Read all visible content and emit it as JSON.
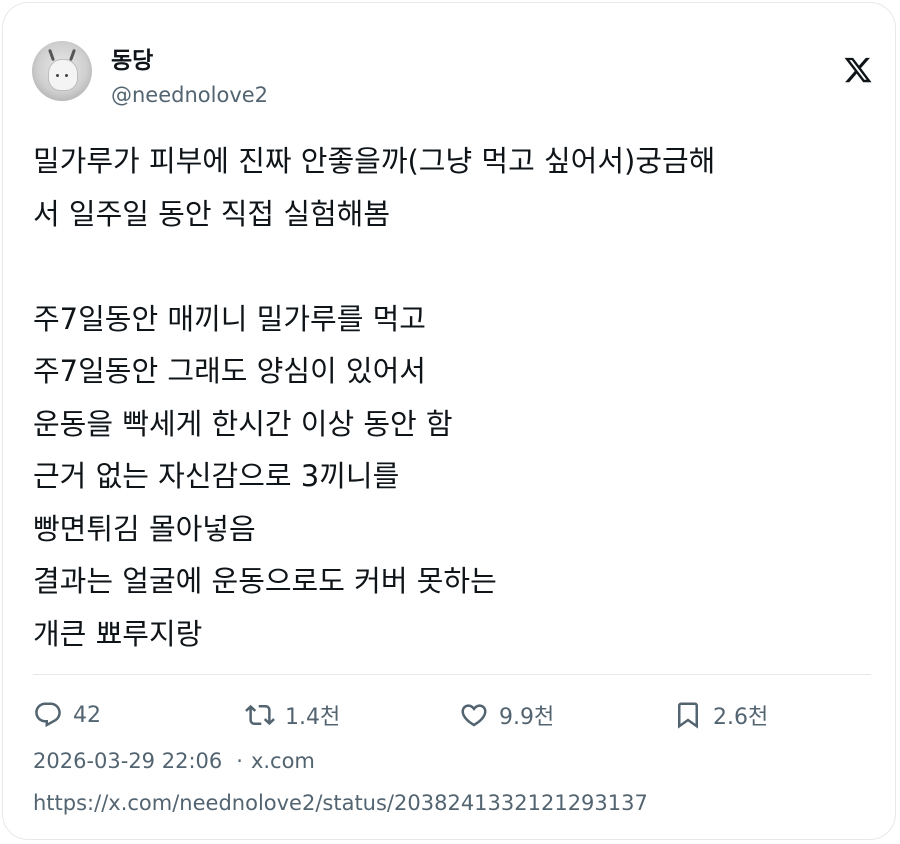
{
  "author": {
    "display_name": "동당",
    "handle": "@neednolove2"
  },
  "logo": "x-logo-icon",
  "tweet": {
    "text": "밀가루가 피부에 진짜 안좋을까(그냥 먹고 싶어서)궁금해\n서 일주일 동안 직접 실험해봄\n\n주7일동안 매끼니 밀가루를 먹고\n주7일동안 그래도 양심이 있어서\n운동을 빡세게 한시간 이상 동안 함\n근거 없는 자신감으로 3끼니를\n빵면튀김 몰아넣음\n결과는 얼굴에 운동으로도 커버 못하는\n개큰 뾰루지랑"
  },
  "actions": {
    "reply": {
      "icon": "reply-icon",
      "count": "42"
    },
    "retweet": {
      "icon": "retweet-icon",
      "count": "1.4천"
    },
    "like": {
      "icon": "heart-icon",
      "count": "9.9천"
    },
    "bookmark": {
      "icon": "bookmark-icon",
      "count": "2.6천"
    }
  },
  "meta": {
    "timestamp": "2026-03-29 22:06",
    "separator": "·",
    "source": "x.com",
    "url": "https://x.com/neednolove2/status/2038241332121293137"
  },
  "colors": {
    "text": "#0f1419",
    "secondary": "#536471",
    "border": "#e6e9ec"
  }
}
